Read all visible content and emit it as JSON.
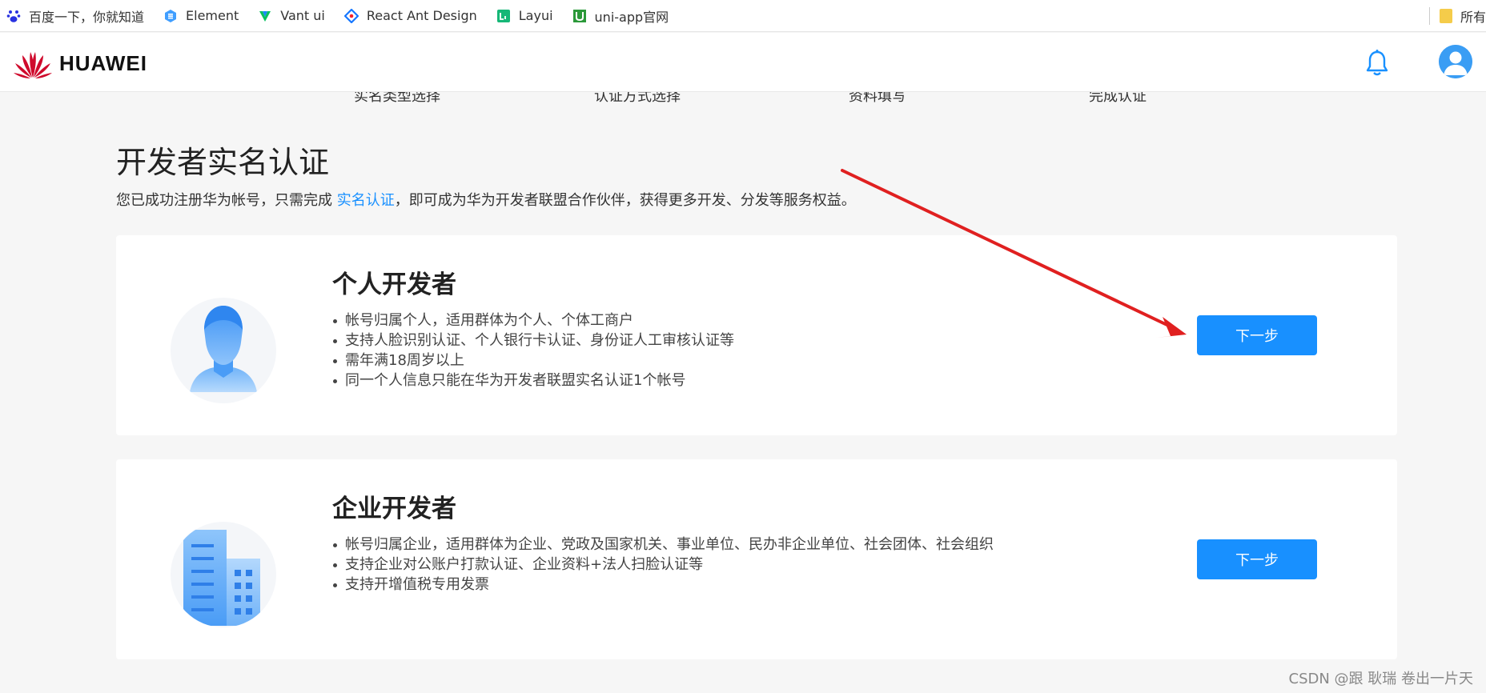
{
  "bookmarks": [
    {
      "label": "百度一下，你就知道",
      "icon": "baidu-paw-icon",
      "color": "#2932e1"
    },
    {
      "label": "Element",
      "icon": "element-icon",
      "color": "#409eff"
    },
    {
      "label": "Vant ui",
      "icon": "vant-icon",
      "color": "#07c160"
    },
    {
      "label": "React Ant Design",
      "icon": "antd-icon",
      "color": "#1677ff"
    },
    {
      "label": "Layui",
      "icon": "layui-icon",
      "color": "#16b777"
    },
    {
      "label": "uni-app官网",
      "icon": "uniapp-icon",
      "color": "#2b9939"
    }
  ],
  "bookmarks_overflow": "所有",
  "header": {
    "brand": "HUAWEI",
    "brand_color": "#cf0a2c"
  },
  "steps": [
    "实名类型选择",
    "认证方式选择",
    "资料填写",
    "完成认证"
  ],
  "page": {
    "title": "开发者实名认证",
    "intro_prefix": "您已成功注册华为帐号，只需完成 ",
    "intro_link": "实名认证",
    "intro_suffix": "，即可成为华为开发者联盟合作伙伴，获得更多开发、分发等服务权益。"
  },
  "cards": [
    {
      "title": "个人开发者",
      "items": [
        "帐号归属个人，适用群体为个人、个体工商户",
        "支持人脸识别认证、个人银行卡认证、身份证人工审核认证等",
        "需年满18周岁以上",
        "同一个人信息只能在华为开发者联盟实名认证1个帐号"
      ],
      "button": "下一步",
      "icon": "person-icon"
    },
    {
      "title": "企业开发者",
      "items": [
        "帐号归属企业，适用群体为企业、党政及国家机关、事业单位、民办非企业单位、社会团体、社会组织",
        "支持企业对公账户打款认证、企业资料+法人扫脸认证等",
        "支持开增值税专用发票"
      ],
      "button": "下一步",
      "icon": "building-icon"
    }
  ],
  "accent_color": "#1890ff",
  "annotation_arrow_color": "#e02020",
  "watermark": "CSDN @跟 耿瑞 卷出一片天"
}
